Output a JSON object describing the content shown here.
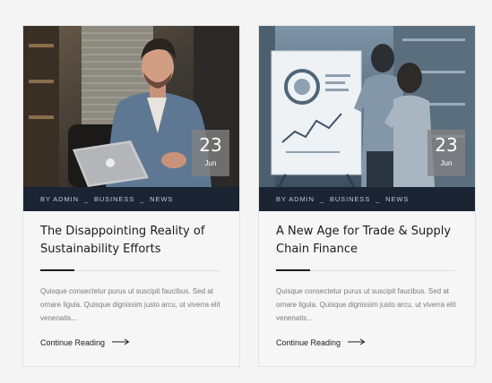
{
  "posts": [
    {
      "image_alt": "man-with-laptop-photo",
      "date": {
        "day": "23",
        "month": "Jun"
      },
      "meta": {
        "prefix": "BY",
        "author": "ADMIN",
        "category": "BUSINESS",
        "tag": "NEWS",
        "separator": "_"
      },
      "title": "The Disappointing Reality of Sustainability Efforts",
      "excerpt": "Quisque consectetur purus ut suscipit faucibus. Sed at ornare ligula. Quisque dignissim justo arcu, ut viverra elit venenatis...",
      "cta": "Continue Reading"
    },
    {
      "image_alt": "presentation-whiteboard-photo",
      "date": {
        "day": "23",
        "month": "Jun"
      },
      "meta": {
        "prefix": "BY",
        "author": "ADMIN",
        "category": "BUSINESS",
        "tag": "NEWS",
        "separator": "_"
      },
      "title": "A New Age for Trade & Supply Chain Finance",
      "excerpt": "Quisque consectetur purus ut suscipit faucibus. Sed at ornare ligula. Quisque dignissim justo arcu, ut viverra elit venenatis...",
      "cta": "Continue Reading"
    }
  ],
  "colors": {
    "meta_bar": "#1a2433",
    "title": "#1c1c1c",
    "excerpt": "#7a7a7a",
    "badge": "#828282"
  }
}
